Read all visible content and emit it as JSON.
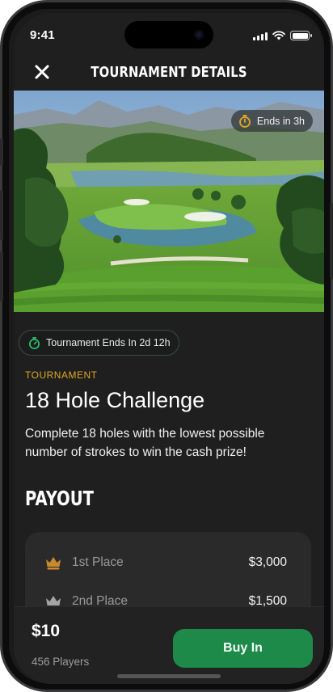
{
  "status": {
    "time": "9:41"
  },
  "header": {
    "title": "TOURNAMENT DETAILS",
    "close_icon": "close-icon"
  },
  "hero": {
    "ends_pill": "Ends in 3h"
  },
  "tournament": {
    "ends_badge": "Tournament Ends In 2d 12h",
    "kicker": "TOURNAMENT",
    "name": "18 Hole Challenge",
    "description": "Complete 18 holes with the lowest possible number of strokes to win the cash prize!"
  },
  "payout": {
    "heading": "PAYOUT",
    "rows": [
      {
        "icon": "gold-crown-icon",
        "label": "1st Place",
        "value": "$3,000"
      },
      {
        "icon": "silver-crown-icon",
        "label": "2nd Place",
        "value": "$1,500"
      }
    ]
  },
  "footer": {
    "price": "$10",
    "players": "456 Players",
    "buy_label": "Buy In"
  },
  "colors": {
    "accent_green": "#1e8a4a",
    "kicker_gold": "#e0a820",
    "timer_green": "#2fbf6a"
  }
}
